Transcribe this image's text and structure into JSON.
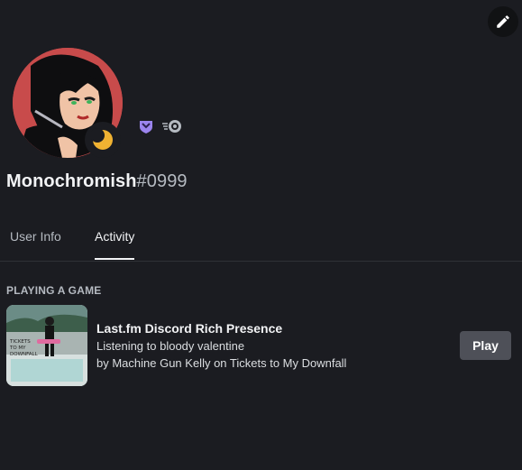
{
  "profile": {
    "username": "Monochromish",
    "discriminator": "#0999",
    "status": "idle",
    "badges": [
      {
        "icon": "hypesquad-icon",
        "color": "#9b84ee"
      },
      {
        "icon": "nitro-boost-icon",
        "color": "#b5bac1"
      }
    ]
  },
  "header": {
    "edit_icon": "pencil-icon"
  },
  "tabs": [
    {
      "label": "User Info",
      "active": false
    },
    {
      "label": "Activity",
      "active": true
    }
  ],
  "activity": {
    "section_title": "PLAYING A GAME",
    "name": "Last.fm Discord Rich Presence",
    "details": "Listening to bloody valentine",
    "state": "by Machine Gun Kelly on Tickets to My Downfall",
    "button_label": "Play",
    "album_art_text": "TICKETS TO MY DOWNFALL"
  },
  "colors": {
    "background": "#1b1c21",
    "idle_status": "#f0b232",
    "button_bg": "#4e5058"
  }
}
